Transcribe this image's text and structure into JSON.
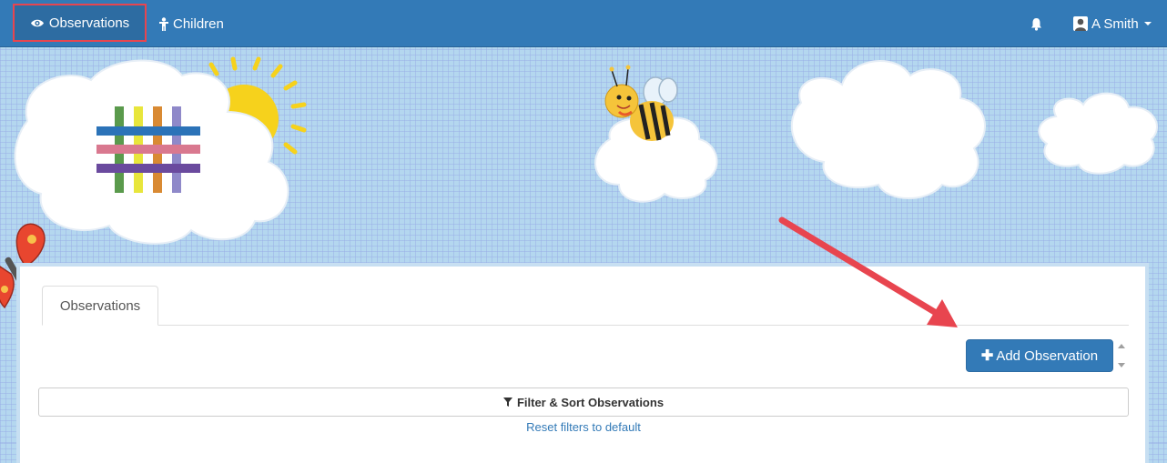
{
  "navbar": {
    "observations_label": "Observations",
    "children_label": "Children",
    "user_name": "A Smith",
    "icons": {
      "observations": "eye-icon",
      "children": "child-icon",
      "notifications": "bell-icon",
      "user": "user-avatar-icon",
      "menu": "caret-down-icon"
    }
  },
  "tabs": [
    {
      "label": "Observations",
      "active": true
    }
  ],
  "toolbar": {
    "add_label": "Add Observation"
  },
  "filter": {
    "label": "Filter & Sort Observations",
    "icon": "filter-icon",
    "reset_label": "Reset filters to default"
  },
  "colors": {
    "primary": "#337ab7",
    "highlight_border": "#e8454f",
    "annotation_arrow": "#e8454f",
    "banner_background": "#b4d7ef"
  }
}
